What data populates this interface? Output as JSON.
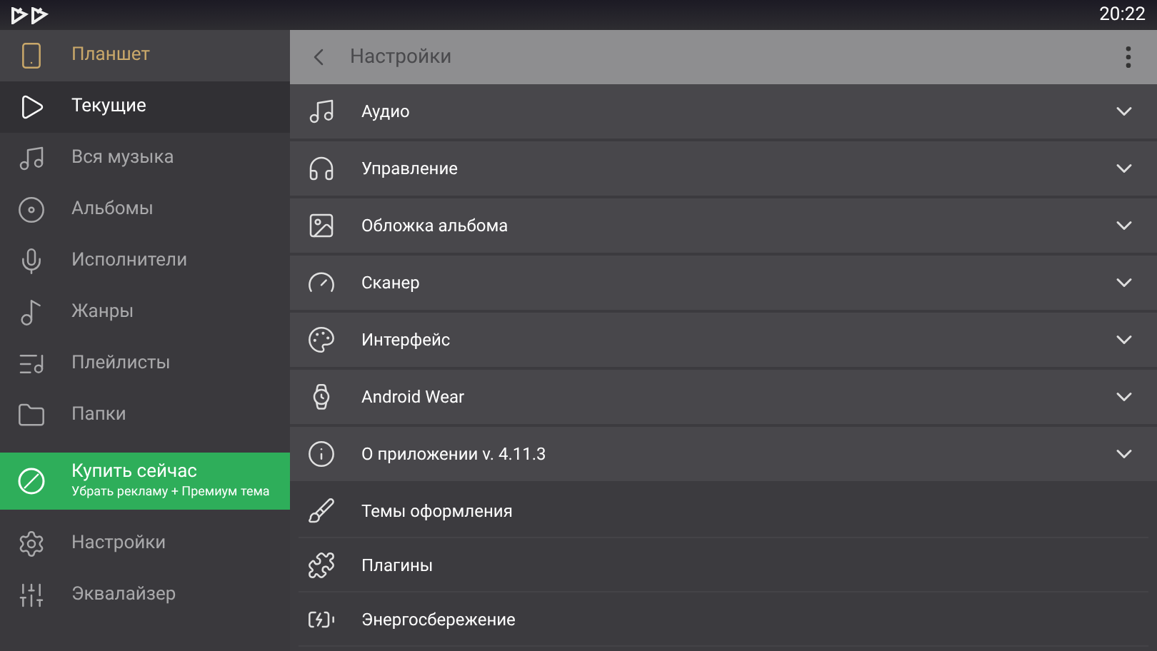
{
  "status_bar": {
    "time": "20:22"
  },
  "sidebar": {
    "device": "Планшет",
    "items": [
      {
        "label": "Текущие",
        "selected": true
      },
      {
        "label": "Вся музыка",
        "selected": false
      },
      {
        "label": "Альбомы",
        "selected": false
      },
      {
        "label": "Исполнители",
        "selected": false
      },
      {
        "label": "Жанры",
        "selected": false
      },
      {
        "label": "Плейлисты",
        "selected": false
      },
      {
        "label": "Папки",
        "selected": false
      }
    ],
    "promo": {
      "title": "Купить сейчас",
      "subtitle": "Убрать рекламу + Премиум тема"
    },
    "bottom_items": [
      {
        "label": "Настройки",
        "selected": false
      },
      {
        "label": "Эквалайзер",
        "selected": false
      }
    ]
  },
  "header": {
    "title": "Настройки"
  },
  "settings": [
    {
      "label": "Аудио",
      "kind": "group",
      "expanded": false
    },
    {
      "label": "Управление",
      "kind": "group",
      "expanded": false
    },
    {
      "label": "Обложка альбома",
      "kind": "group",
      "expanded": false
    },
    {
      "label": "Сканер",
      "kind": "group",
      "expanded": false
    },
    {
      "label": "Интерфейс",
      "kind": "group",
      "expanded": false
    },
    {
      "label": "Android Wear",
      "kind": "group",
      "expanded": false
    },
    {
      "label": "О приложении v. 4.11.3",
      "kind": "group",
      "expanded": false
    },
    {
      "label": "Темы оформления",
      "kind": "link"
    },
    {
      "label": "Плагины",
      "kind": "link"
    },
    {
      "label": "Энергосбережение",
      "kind": "link"
    }
  ]
}
